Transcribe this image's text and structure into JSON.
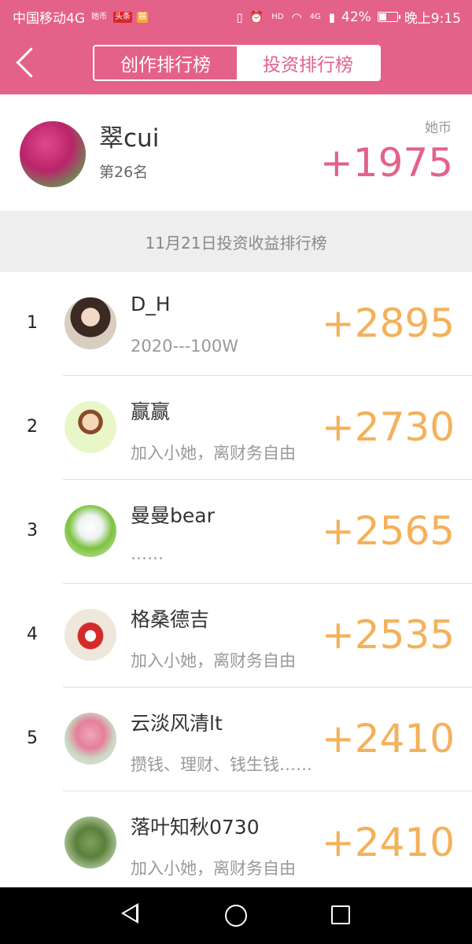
{
  "status_bar": {
    "carrier": "中国移动4G",
    "badge_a": "她币",
    "badge_b": "头条",
    "badge_c": "囍",
    "battery_level": 0.42,
    "nfc_text": "HD",
    "network_text": "4G",
    "battery_percent": "42%",
    "time": "晚上9:15"
  },
  "header": {
    "tabs": [
      {
        "label": "创作排行榜",
        "active": false
      },
      {
        "label": "投资排行榜",
        "active": true
      }
    ]
  },
  "me": {
    "name": "翠cui",
    "rank_text": "第26名",
    "unit": "她币",
    "score": "+1975"
  },
  "daybar": {
    "title": "11月21日投资收益排行榜"
  },
  "ranking": [
    {
      "rank": "1",
      "name": "D_H",
      "signature": "2020---100W",
      "score": "+2895"
    },
    {
      "rank": "2",
      "name": "赢赢",
      "signature": "加入小她，离财务自由",
      "score": "+2730"
    },
    {
      "rank": "3",
      "name": "曼曼bear",
      "signature": "……",
      "score": "+2565"
    },
    {
      "rank": "4",
      "name": "格桑德吉",
      "signature": "加入小她，离财务自由",
      "score": "+2535"
    },
    {
      "rank": "5",
      "name": "云淡风清lt",
      "signature": "攒钱、理财、钱生钱……",
      "score": "+2410"
    },
    {
      "rank": "",
      "name": "落叶知秋0730",
      "signature": "加入小她，离财务自由",
      "score": "+2410"
    }
  ],
  "colors": {
    "brand_pink": "#e4628a",
    "score_orange": "#f5b05a"
  }
}
